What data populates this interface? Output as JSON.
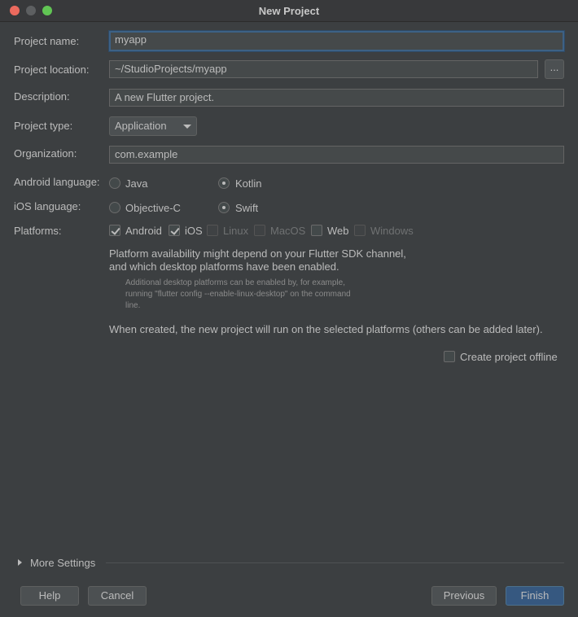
{
  "window": {
    "title": "New Project"
  },
  "form": {
    "project_name": {
      "label": "Project name:",
      "value": "myapp"
    },
    "project_location": {
      "label": "Project location:",
      "value": "~/StudioProjects/myapp",
      "browse_label": "..."
    },
    "description": {
      "label": "Description:",
      "value": "A new Flutter project."
    },
    "project_type": {
      "label": "Project type:",
      "value": "Application"
    },
    "organization": {
      "label": "Organization:",
      "value": "com.example"
    },
    "android_language": {
      "label": "Android language:",
      "options": [
        {
          "label": "Java",
          "selected": false
        },
        {
          "label": "Kotlin",
          "selected": true
        }
      ]
    },
    "ios_language": {
      "label": "iOS language:",
      "options": [
        {
          "label": "Objective-C",
          "selected": false
        },
        {
          "label": "Swift",
          "selected": true
        }
      ]
    },
    "platforms": {
      "label": "Platforms:",
      "items": [
        {
          "label": "Android",
          "checked": true,
          "enabled": true
        },
        {
          "label": "iOS",
          "checked": true,
          "enabled": true
        },
        {
          "label": "Linux",
          "checked": false,
          "enabled": false
        },
        {
          "label": "MacOS",
          "checked": false,
          "enabled": false
        },
        {
          "label": "Web",
          "checked": false,
          "enabled": true
        },
        {
          "label": "Windows",
          "checked": false,
          "enabled": false
        }
      ],
      "availability_line1": "Platform availability might depend on your Flutter SDK channel,",
      "availability_line2": "and which desktop platforms have been enabled.",
      "hint_line1": "Additional desktop platforms can be enabled by, for example,",
      "hint_line2": "running \"flutter config --enable-linux-desktop\" on the command",
      "hint_line3": "line.",
      "created_note": "When created, the new project will run on the selected platforms (others can be added later)."
    },
    "offline": {
      "label": "Create project offline",
      "checked": false
    }
  },
  "more_settings": {
    "label": "More Settings"
  },
  "buttons": {
    "help": "Help",
    "cancel": "Cancel",
    "previous": "Previous",
    "finish": "Finish"
  }
}
